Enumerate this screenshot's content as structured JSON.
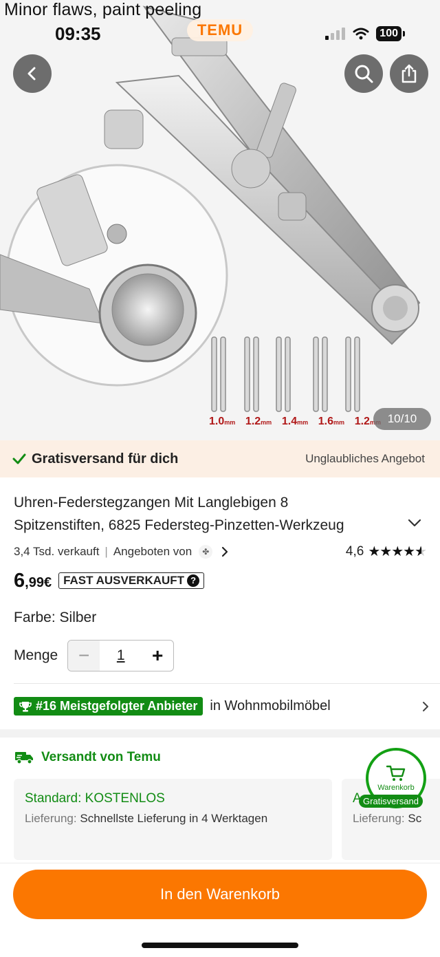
{
  "overlay_text": "Minor flaws, paint peeling",
  "status": {
    "time": "09:35",
    "app_badge": "TEMU",
    "battery": "100"
  },
  "nav": {
    "back_icon": "chevron-left-icon",
    "search_icon": "search-icon",
    "share_icon": "share-icon"
  },
  "gallery": {
    "counter": "10/10",
    "pin_sizes": [
      "1.0",
      "1.2",
      "1.4",
      "1.6",
      "1.2"
    ],
    "pin_unit": "mm"
  },
  "shipping_banner": {
    "left": "Gratisversand für dich",
    "right": "Unglaubliches Angebot"
  },
  "product": {
    "title_line1": "Uhren-Federstegzangen Mit Langlebigen 8",
    "title_line2": "Spitzenstiften, 6825 Federsteg-Pinzetten-Werkzeug",
    "sold": "3,4 Tsd. verkauft",
    "offered_by": "Angeboten von",
    "rating": "4,6",
    "rating_value": 4.6,
    "price_int": "6",
    "price_dec": ",99€",
    "badge": "FAST AUSVERKAUFT",
    "color_label": "Farbe: Silber",
    "qty_label": "Menge",
    "qty_value": "1",
    "qty_minus": "−",
    "qty_plus": "+"
  },
  "rank": {
    "badge": "#16 Meistgefolgter Anbieter",
    "text": "in Wohnmobilmöbel"
  },
  "versand": {
    "label": "Versandt von Temu"
  },
  "ship_options": [
    {
      "title": "Standard: KOSTENLOS",
      "label": "Lieferung:",
      "value": "Schnellste Lieferung in 4 Werktagen"
    },
    {
      "title": "A",
      "label": "Lieferung:",
      "value": "Sc"
    }
  ],
  "cart_bubble": {
    "label": "Warenkorb",
    "free": "Gratisversand"
  },
  "cta": {
    "label": "In den Warenkorb"
  },
  "colors": {
    "accent": "#fb7701",
    "green": "#128c14",
    "banner_bg": "#fcefe4"
  }
}
